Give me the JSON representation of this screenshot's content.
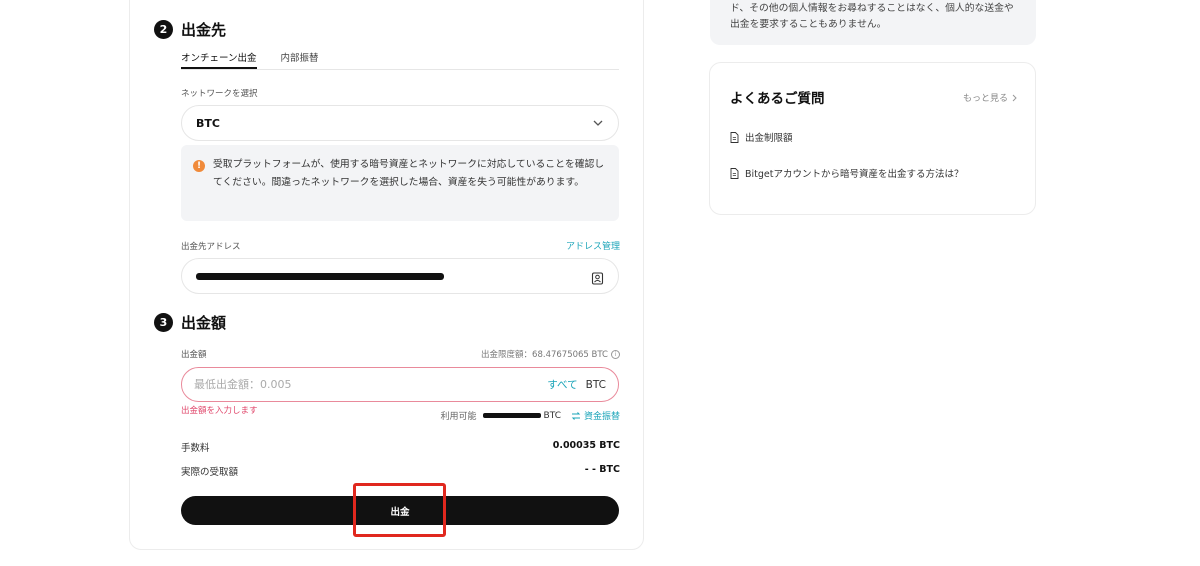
{
  "section2": {
    "step": "2",
    "title": "出金先"
  },
  "tabs": [
    {
      "label": "オンチェーン出金",
      "active": true
    },
    {
      "label": "内部振替",
      "active": false
    }
  ],
  "network": {
    "label": "ネットワークを選択",
    "value": "BTC"
  },
  "notice": {
    "icon": "warning-icon",
    "text": "受取プラットフォームが、使用する暗号資産とネットワークに対応していることを確認してください。間違ったネットワークを選択した場合、資産を失う可能性があります。",
    "color": "#f08a3a"
  },
  "address": {
    "label": "出金先アドレス",
    "manage_link": "アドレス管理"
  },
  "section3": {
    "step": "3",
    "title": "出金額"
  },
  "amount": {
    "label": "出金額",
    "limit": "出金限度額：68.47675065 BTC",
    "placeholder": "最低出金額：0.005",
    "all_label": "すべて",
    "unit": "BTC",
    "error": "出金額を入力します",
    "available_label": "利用可能",
    "available_unit": "BTC",
    "transfer_label": "資金振替"
  },
  "fee": {
    "label": "手数料",
    "value": "0.00035 BTC"
  },
  "received": {
    "label": "実際の受取額",
    "value": "- - BTC"
  },
  "submit": {
    "label": "出金"
  },
  "right_top_notice": {
    "text": "ド、その他の個人情報をお尋ねすることはなく、個人的な送金や出金を要求することもありません。"
  },
  "faq": {
    "title": "よくあるご質問",
    "more": "もっと見る",
    "items": [
      {
        "label": "出金制限額"
      },
      {
        "label": "Bitgetアカウントから暗号資産を出金する方法は？"
      }
    ]
  },
  "colors": {
    "accent": "#1aa4b8",
    "error": "#e0476b",
    "highlight": "#e0281e",
    "button": "#111111"
  }
}
